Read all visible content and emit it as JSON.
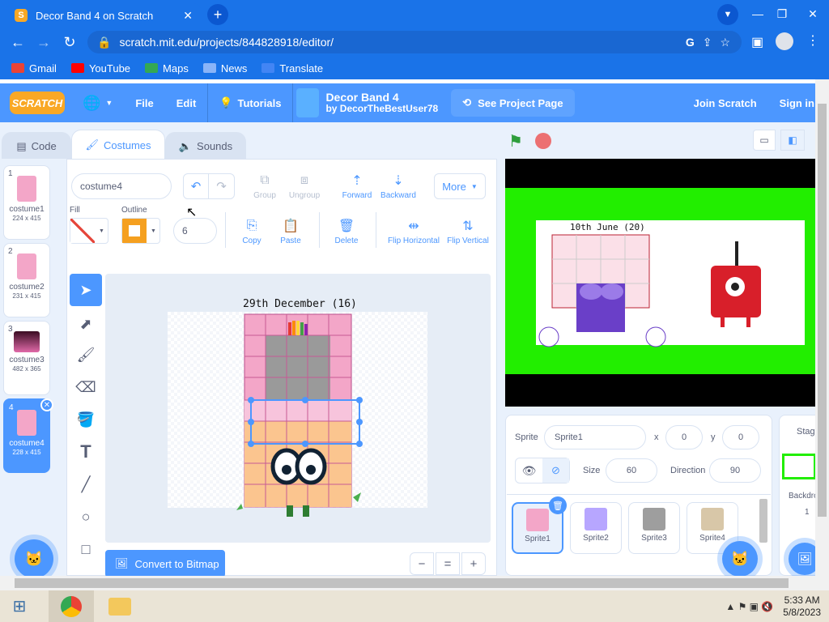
{
  "browser": {
    "tab_title": "Decor Band 4 on Scratch",
    "tab_favicon": "S",
    "url": "scratch.mit.edu/projects/844828918/editor/",
    "bookmarks": [
      {
        "label": "Gmail",
        "color": "#ea4335"
      },
      {
        "label": "YouTube",
        "color": "#ff0000"
      },
      {
        "label": "Maps",
        "color": "#34a853"
      },
      {
        "label": "News",
        "color": "#8ab4f8"
      },
      {
        "label": "Translate",
        "color": "#4285f4"
      }
    ]
  },
  "menubar": {
    "logo": "SCRATCH",
    "file": "File",
    "edit": "Edit",
    "tutorials": "Tutorials",
    "project_title": "Decor Band 4",
    "project_author": "by DecorTheBestUser78",
    "see_project": "See Project Page",
    "join": "Join Scratch",
    "signin": "Sign in"
  },
  "editor_tabs": {
    "code": "Code",
    "costumes": "Costumes",
    "sounds": "Sounds"
  },
  "costumes": [
    {
      "num": "1",
      "name": "costume1",
      "size": "224 x 415",
      "color": "#f3a6c8"
    },
    {
      "num": "2",
      "name": "costume2",
      "size": "231 x 415",
      "color": "#f3a6c8"
    },
    {
      "num": "3",
      "name": "costume3",
      "size": "482 x 365",
      "color": "#5b1a3a"
    },
    {
      "num": "4",
      "name": "costume4",
      "size": "228 x 415",
      "color": "#f3a6c8"
    }
  ],
  "paint": {
    "costume_name": "costume4",
    "fill_label": "Fill",
    "outline_label": "Outline",
    "outline_width": "6",
    "group": "Group",
    "ungroup": "Ungroup",
    "forward": "Forward",
    "backward": "Backward",
    "more": "More",
    "copy": "Copy",
    "paste": "Paste",
    "delete": "Delete",
    "flip_h": "Flip Horizontal",
    "flip_v": "Flip Vertical",
    "canvas_caption": "29th December (16)",
    "convert": "Convert to Bitmap",
    "zoom_out": "−",
    "zoom_reset": "=",
    "zoom_in": "+"
  },
  "stage": {
    "caption": "10th June (20)",
    "bg_color": "#22ee00"
  },
  "sprite_info": {
    "sprite_label": "Sprite",
    "sprite_name": "Sprite1",
    "x_label": "x",
    "x_value": "0",
    "y_label": "y",
    "y_value": "0",
    "size_label": "Size",
    "size_value": "60",
    "direction_label": "Direction",
    "direction_value": "90"
  },
  "sprites": [
    {
      "name": "Sprite1",
      "color": "#f3a6c8"
    },
    {
      "name": "Sprite2",
      "color": "#b7a6ff"
    },
    {
      "name": "Sprite3",
      "color": "#9e9e9e"
    },
    {
      "name": "Sprite4",
      "color": "#d8c7a8"
    }
  ],
  "stage_panel": {
    "title": "Stage",
    "backdrops_label": "Backdro",
    "backdrops_count": "1"
  },
  "taskbar": {
    "time": "5:33 AM",
    "date": "5/8/2023"
  }
}
